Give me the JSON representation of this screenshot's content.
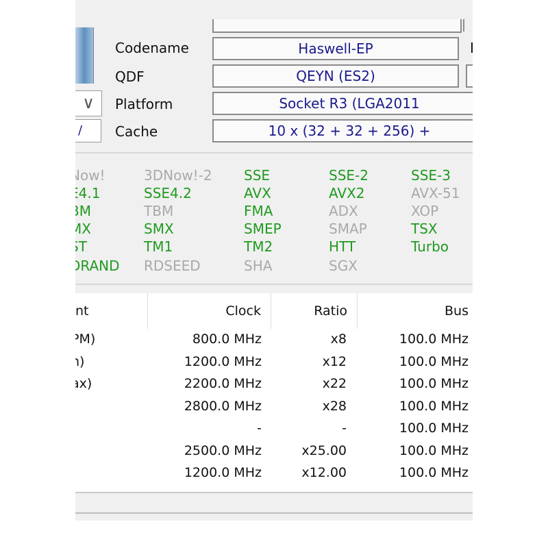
{
  "info": {
    "rows": [
      {
        "label": "Codename",
        "value": "Haswell-EP",
        "side_label": "I"
      },
      {
        "label": "QDF",
        "value": "QEYN (ES2)"
      },
      {
        "label": "Platform",
        "value": "Socket R3 (LGA2011"
      },
      {
        "label": "Cache",
        "value": "10 x (32 + 32 + 256) +"
      }
    ],
    "dropdown_glyph": "∨",
    "small_box_text": "/"
  },
  "instructions": [
    {
      "name": "Now!",
      "enabled": false
    },
    {
      "name": "3DNow!-2",
      "enabled": false
    },
    {
      "name": "SSE",
      "enabled": true
    },
    {
      "name": "SSE-2",
      "enabled": true
    },
    {
      "name": "SSE-3",
      "enabled": true
    },
    {
      "name": "E4.1",
      "enabled": true
    },
    {
      "name": "SSE4.2",
      "enabled": true
    },
    {
      "name": "AVX",
      "enabled": true
    },
    {
      "name": "AVX2",
      "enabled": true
    },
    {
      "name": "AVX-51",
      "enabled": false
    },
    {
      "name": "BM",
      "enabled": true
    },
    {
      "name": "TBM",
      "enabled": false
    },
    {
      "name": "FMA",
      "enabled": true
    },
    {
      "name": "ADX",
      "enabled": false
    },
    {
      "name": "XOP",
      "enabled": false
    },
    {
      "name": "MX",
      "enabled": true
    },
    {
      "name": "SMX",
      "enabled": true
    },
    {
      "name": "SMEP",
      "enabled": true
    },
    {
      "name": "SMAP",
      "enabled": false
    },
    {
      "name": "TSX",
      "enabled": true
    },
    {
      "name": "ST",
      "enabled": true
    },
    {
      "name": "TM1",
      "enabled": true
    },
    {
      "name": "TM2",
      "enabled": true
    },
    {
      "name": "HTT",
      "enabled": true
    },
    {
      "name": "Turbo",
      "enabled": true
    },
    {
      "name": "DRAND",
      "enabled": true
    },
    {
      "name": "RDSEED",
      "enabled": false
    },
    {
      "name": "SHA",
      "enabled": false
    },
    {
      "name": "SGX",
      "enabled": false
    }
  ],
  "clocks": {
    "headers": [
      "nt",
      "Clock",
      "Ratio",
      "Bus"
    ],
    "rows": [
      [
        "PM)",
        "800.0 MHz",
        "x8",
        "100.0 MHz"
      ],
      [
        "n)",
        "1200.0 MHz",
        "x12",
        "100.0 MHz"
      ],
      [
        "ax)",
        "2200.0 MHz",
        "x22",
        "100.0 MHz"
      ],
      [
        "",
        "2800.0 MHz",
        "x28",
        "100.0 MHz"
      ],
      [
        "",
        "-",
        "-",
        "100.0 MHz"
      ],
      [
        "",
        "2500.0 MHz",
        "x25.00",
        "100.0 MHz"
      ],
      [
        ":",
        "1200.0 MHz",
        "x12.00",
        "100.0 MHz"
      ]
    ]
  },
  "colors": {
    "enabled": "#1f9a1f",
    "disabled": "#a9a9a9",
    "value_text": "#1a1a8c"
  }
}
